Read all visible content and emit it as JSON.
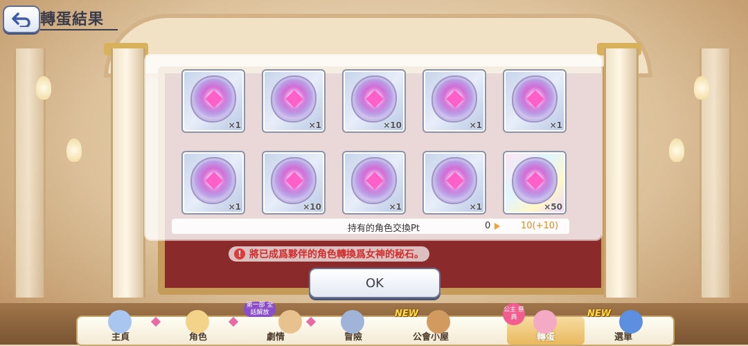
{
  "header": {
    "title": "轉蛋結果"
  },
  "items": [
    {
      "qty": "×1"
    },
    {
      "qty": "×1"
    },
    {
      "qty": "×10"
    },
    {
      "qty": "×1"
    },
    {
      "qty": "×1"
    },
    {
      "qty": "×1"
    },
    {
      "qty": "×10"
    },
    {
      "qty": "×1"
    },
    {
      "qty": "×1"
    },
    {
      "qty": "×50"
    }
  ],
  "points": {
    "label": "持有的角色交換Pt",
    "old_value": "0",
    "new_value": "10(+10)"
  },
  "notice": "將已成爲夥伴的角色轉換爲女神的秘石。",
  "ok_label": "OK",
  "nav": {
    "home": "主頁",
    "character": "角色",
    "story": "劇情",
    "adventure": "冒險",
    "guild": "公會小屋",
    "gacha": "轉蛋",
    "menu": "選單",
    "new_label": "NEW",
    "story_ribbon": "第一部 全話解放",
    "gacha_badge": "公主 祭典"
  },
  "colors": {
    "notice_red": "#d12d2d",
    "pt_orange": "#e38a1a",
    "new_yellow": "#ffd84a",
    "active_tab": "#e9b85e"
  }
}
